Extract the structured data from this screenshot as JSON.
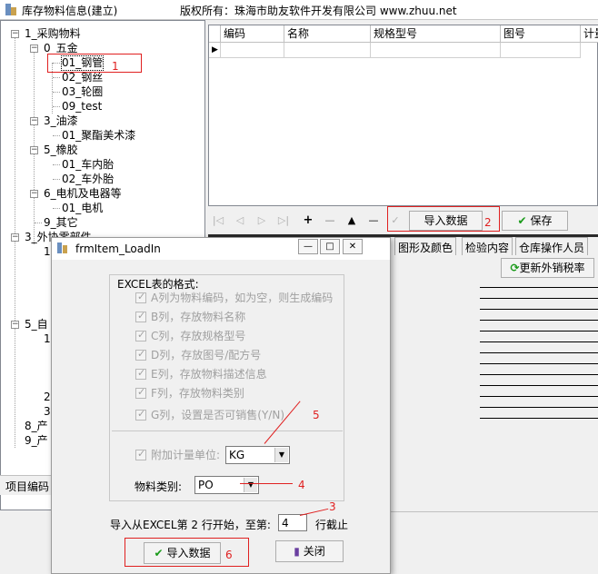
{
  "window": {
    "title": "库存物料信息(建立)",
    "copyright": "版权所有：珠海市助友软件开发有限公司 www.zhuu.net"
  },
  "tree": {
    "nodes": [
      {
        "label": "1_采购物料"
      },
      {
        "label": "0_五金"
      },
      {
        "label": "01_钢管"
      },
      {
        "label": "02_钢丝"
      },
      {
        "label": "03_轮圈"
      },
      {
        "label": "09_test"
      },
      {
        "label": "3_油漆"
      },
      {
        "label": "01_聚酯美术漆"
      },
      {
        "label": "5_橡胶"
      },
      {
        "label": "01_车内胎"
      },
      {
        "label": "02_车外胎"
      },
      {
        "label": "6_电机及电器等"
      },
      {
        "label": "01_电机"
      },
      {
        "label": "9_其它"
      },
      {
        "label": "3_外协零部件"
      },
      {
        "label": "1"
      },
      {
        "label": "5_自"
      },
      {
        "label": "1"
      },
      {
        "label": "2"
      },
      {
        "label": "3"
      },
      {
        "label": "8_产"
      },
      {
        "label": "9_产"
      }
    ],
    "footer_label": "项目编码"
  },
  "grid": {
    "columns": [
      "编码",
      "名称",
      "规格型号",
      "图号",
      "计量"
    ]
  },
  "toolbar": {
    "import_label": "导入数据",
    "save_label": "保存"
  },
  "tabs": {
    "items": [
      "图形及颜色",
      "检验内容",
      "仓库操作人员"
    ],
    "update_tax": "更新外销税率"
  },
  "annotations": {
    "n1": "1",
    "n2": "2",
    "n3": "3",
    "n4": "4",
    "n5": "5",
    "n6": "6"
  },
  "dialog": {
    "title": "frmItem_LoadIn",
    "group_title": "EXCEL表的格式:",
    "columns": [
      "A列为物料编码，如为空，则生成编码",
      "B列，存放物料名称",
      "C列，存放规格型号",
      "D列，存放图号/配方号",
      "E列，存放物料描述信息",
      "F列，存放物料类别",
      "G列，设置是否可销售(Y/N)"
    ],
    "unit_label": "附加计量单位:",
    "unit_value": "KG",
    "category_label": "物料类别:",
    "category_value": "PO",
    "range_prefix": "导入从EXCEL第 2 行开始，至第:",
    "range_value": "4",
    "range_suffix": "行截止",
    "import_button": "导入数据",
    "close_button": "关闭"
  }
}
